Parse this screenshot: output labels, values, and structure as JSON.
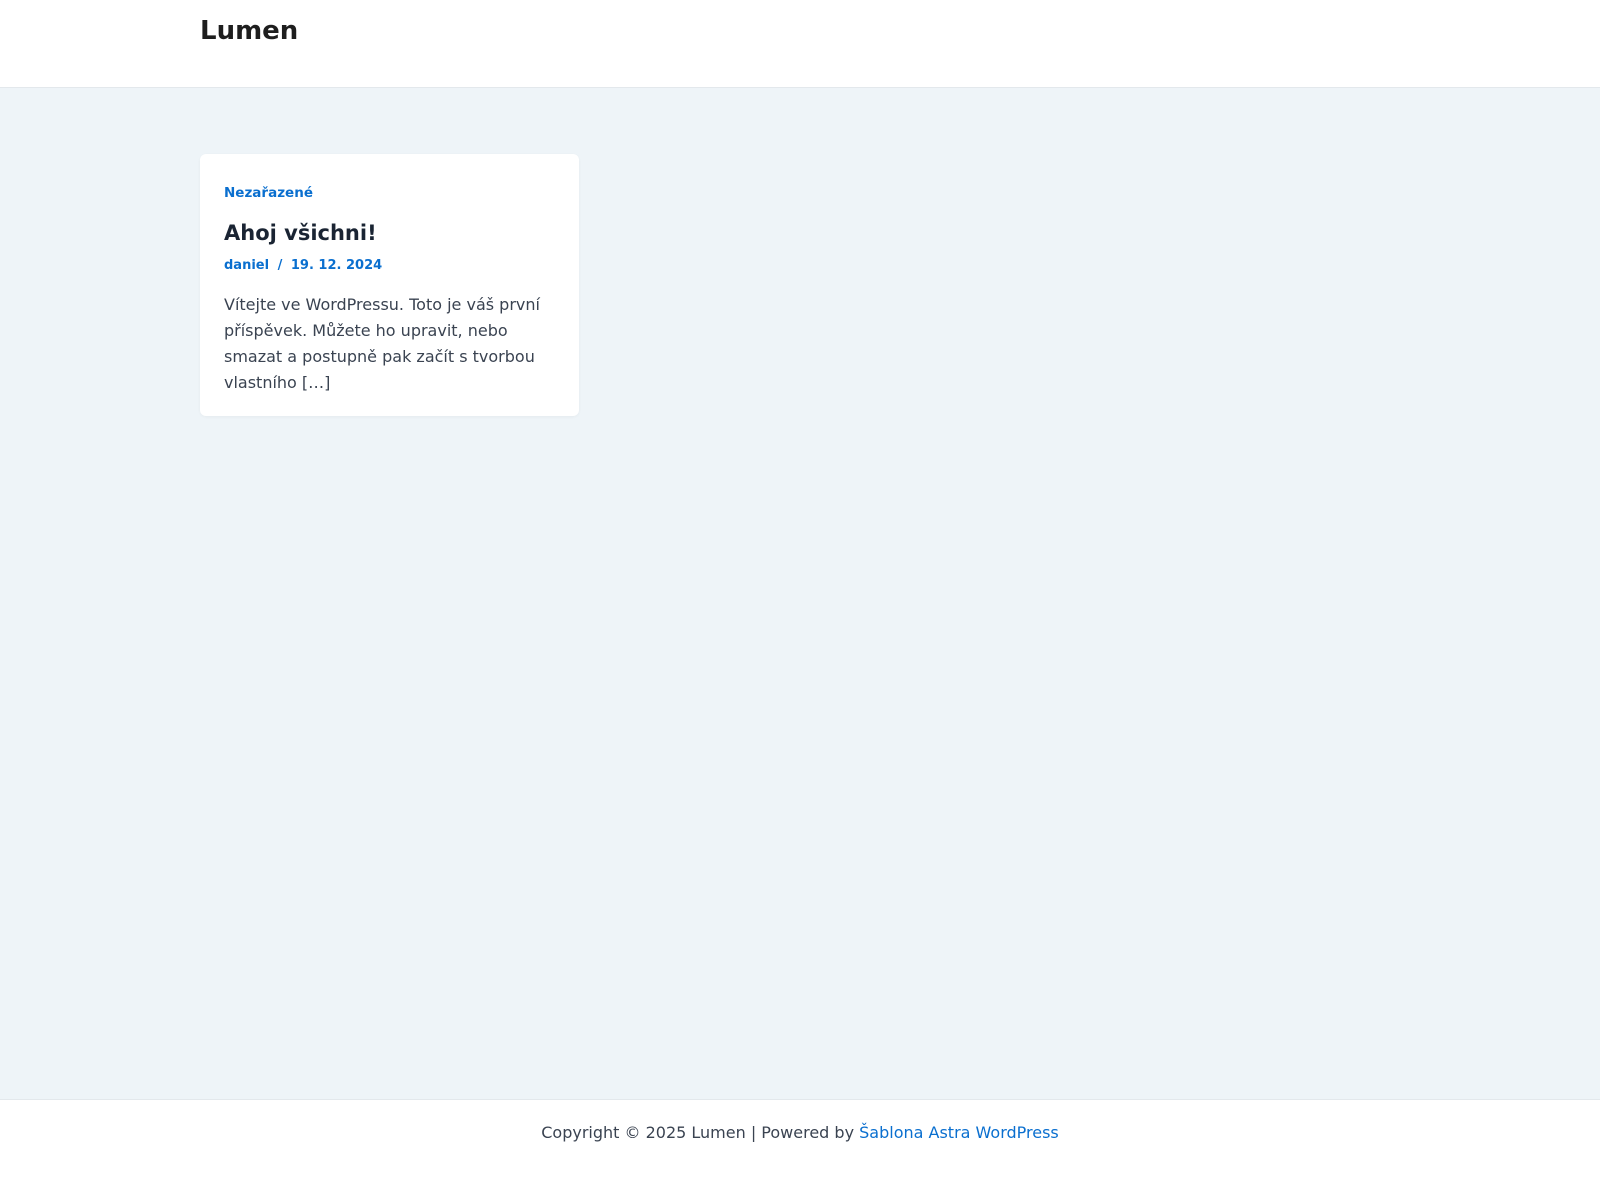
{
  "header": {
    "site_title": "Lumen"
  },
  "post": {
    "category": "Nezařazené",
    "title": "Ahoj všichni!",
    "author": "daniel",
    "meta_separator": "/",
    "date": "19. 12. 2024",
    "excerpt": "Vítejte ve WordPressu. Toto je váš první příspěvek. Můžete ho upravit, nebo smazat a postupně pak začít s tvorbou vlastního […]"
  },
  "footer": {
    "copyright_text": "Copyright © 2025 Lumen | Powered by",
    "theme_link_label": "Šablona Astra WordPress"
  },
  "colors": {
    "accent": "#0a6fcf",
    "background": "#eef4f8",
    "card": "#ffffff",
    "heading": "#1a2433",
    "body_text": "#3a4351"
  }
}
